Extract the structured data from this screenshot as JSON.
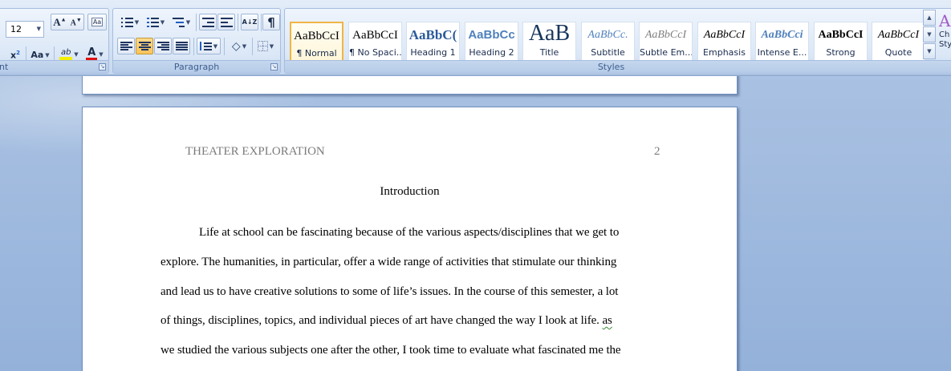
{
  "ribbon": {
    "font": {
      "group_label": "nt",
      "font_size": "12",
      "grow_label": "A",
      "shrink_label": "A",
      "clear_label": "Aa",
      "superscript_label": "x",
      "superscript_mark": "2",
      "case_label": "Aa",
      "highlight_label": "ab",
      "font_color_label": "A",
      "colors": {
        "highlight": "#f5f000",
        "font_color": "#e01010"
      }
    },
    "paragraph": {
      "group_label": "Paragraph",
      "sort_label": "A↓Z",
      "pilcrow_label": "¶"
    },
    "styles": {
      "group_label": "Styles",
      "items": [
        {
          "sample": "AaBbCcI",
          "name": "¶ Normal"
        },
        {
          "sample": "AaBbCcI",
          "name": "¶ No Spaci..."
        },
        {
          "sample": "AaBbC(",
          "name": "Heading 1"
        },
        {
          "sample": "AaBbCc",
          "name": "Heading 2"
        },
        {
          "sample": "AaB",
          "name": "Title"
        },
        {
          "sample": "AaBbCc.",
          "name": "Subtitle"
        },
        {
          "sample": "AaBbCcI",
          "name": "Subtle Em..."
        },
        {
          "sample": "AaBbCcI",
          "name": "Emphasis"
        },
        {
          "sample": "AaBbCci",
          "name": "Intense E..."
        },
        {
          "sample": "AaBbCcI",
          "name": "Strong"
        },
        {
          "sample": "AaBbCcI",
          "name": "Quote"
        }
      ],
      "change_styles": {
        "icon_letter": "A",
        "line1": "Ch",
        "line2": "Sty"
      }
    }
  },
  "document": {
    "header_left": "THEATER EXPLORATION",
    "header_right": "2",
    "title": "Introduction",
    "lines": [
      "Life at school can be fascinating because of the various aspects/disciplines that we get to",
      "explore. The humanities, in particular, offer a wide range of activities that stimulate our thinking",
      "and lead us to have creative solutions to some of life’s issues. In the course of this semester, a lot",
      "of things, disciplines, topics, and individual pieces of art have changed the way I look at life.",
      "we studied the various subjects one after the other, I took time to evaluate what fascinated me the"
    ],
    "flagged_word": "as"
  }
}
